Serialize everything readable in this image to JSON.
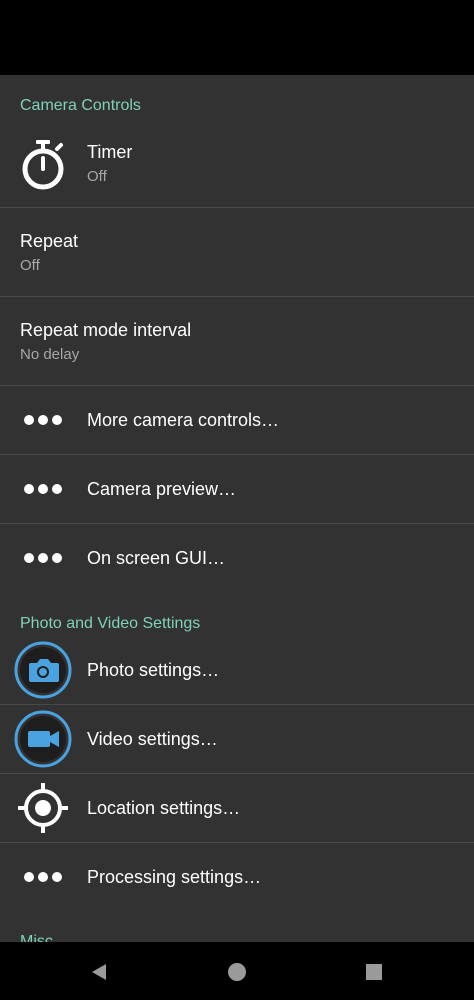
{
  "sections": {
    "camera_controls": "Camera Controls",
    "photo_video": "Photo and Video Settings",
    "misc": "Misc"
  },
  "camera_controls": {
    "timer": {
      "title": "Timer",
      "summary": "Off",
      "icon": "timer-icon"
    },
    "repeat": {
      "title": "Repeat",
      "summary": "Off"
    },
    "repeat_interval": {
      "title": "Repeat mode interval",
      "summary": "No delay"
    },
    "more_camera_controls": {
      "title": "More camera controls…",
      "icon": "more-dots-icon"
    },
    "camera_preview": {
      "title": "Camera preview…",
      "icon": "more-dots-icon"
    },
    "on_screen_gui": {
      "title": "On screen GUI…",
      "icon": "more-dots-icon"
    }
  },
  "photo_video": {
    "photo_settings": {
      "title": "Photo settings…",
      "icon": "camera-icon"
    },
    "video_settings": {
      "title": "Video settings…",
      "icon": "video-camera-icon"
    },
    "location_settings": {
      "title": "Location settings…",
      "icon": "location-crosshair-icon"
    },
    "processing_settings": {
      "title": "Processing settings…",
      "icon": "more-dots-icon"
    }
  },
  "colors": {
    "background": "#323232",
    "section_header": "#7fd1b9",
    "accent_blue": "#4aa3e0",
    "divider": "#4a4a4a"
  },
  "nav": {
    "back": "back-triangle-icon",
    "home": "home-circle-icon",
    "recents": "recents-square-icon"
  }
}
